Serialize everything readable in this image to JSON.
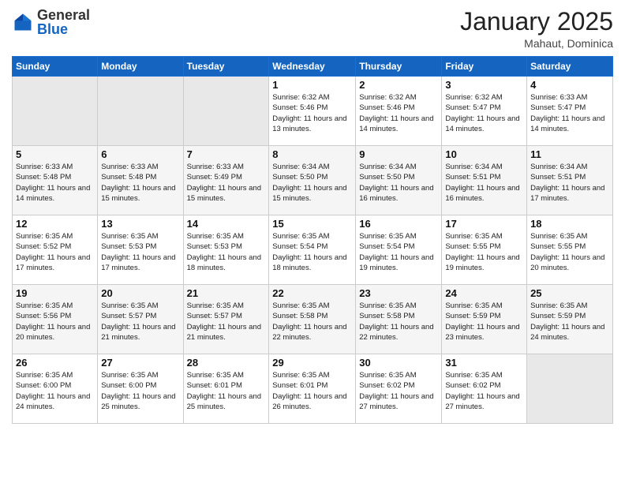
{
  "header": {
    "logo": {
      "general": "General",
      "blue": "Blue"
    },
    "title": "January 2025",
    "location": "Mahaut, Dominica"
  },
  "weekdays": [
    "Sunday",
    "Monday",
    "Tuesday",
    "Wednesday",
    "Thursday",
    "Friday",
    "Saturday"
  ],
  "weeks": [
    [
      {
        "day": "",
        "sunrise": "",
        "sunset": "",
        "daylight": ""
      },
      {
        "day": "",
        "sunrise": "",
        "sunset": "",
        "daylight": ""
      },
      {
        "day": "",
        "sunrise": "",
        "sunset": "",
        "daylight": ""
      },
      {
        "day": "1",
        "sunrise": "Sunrise: 6:32 AM",
        "sunset": "Sunset: 5:46 PM",
        "daylight": "Daylight: 11 hours and 13 minutes."
      },
      {
        "day": "2",
        "sunrise": "Sunrise: 6:32 AM",
        "sunset": "Sunset: 5:46 PM",
        "daylight": "Daylight: 11 hours and 14 minutes."
      },
      {
        "day": "3",
        "sunrise": "Sunrise: 6:32 AM",
        "sunset": "Sunset: 5:47 PM",
        "daylight": "Daylight: 11 hours and 14 minutes."
      },
      {
        "day": "4",
        "sunrise": "Sunrise: 6:33 AM",
        "sunset": "Sunset: 5:47 PM",
        "daylight": "Daylight: 11 hours and 14 minutes."
      }
    ],
    [
      {
        "day": "5",
        "sunrise": "Sunrise: 6:33 AM",
        "sunset": "Sunset: 5:48 PM",
        "daylight": "Daylight: 11 hours and 14 minutes."
      },
      {
        "day": "6",
        "sunrise": "Sunrise: 6:33 AM",
        "sunset": "Sunset: 5:48 PM",
        "daylight": "Daylight: 11 hours and 15 minutes."
      },
      {
        "day": "7",
        "sunrise": "Sunrise: 6:33 AM",
        "sunset": "Sunset: 5:49 PM",
        "daylight": "Daylight: 11 hours and 15 minutes."
      },
      {
        "day": "8",
        "sunrise": "Sunrise: 6:34 AM",
        "sunset": "Sunset: 5:50 PM",
        "daylight": "Daylight: 11 hours and 15 minutes."
      },
      {
        "day": "9",
        "sunrise": "Sunrise: 6:34 AM",
        "sunset": "Sunset: 5:50 PM",
        "daylight": "Daylight: 11 hours and 16 minutes."
      },
      {
        "day": "10",
        "sunrise": "Sunrise: 6:34 AM",
        "sunset": "Sunset: 5:51 PM",
        "daylight": "Daylight: 11 hours and 16 minutes."
      },
      {
        "day": "11",
        "sunrise": "Sunrise: 6:34 AM",
        "sunset": "Sunset: 5:51 PM",
        "daylight": "Daylight: 11 hours and 17 minutes."
      }
    ],
    [
      {
        "day": "12",
        "sunrise": "Sunrise: 6:35 AM",
        "sunset": "Sunset: 5:52 PM",
        "daylight": "Daylight: 11 hours and 17 minutes."
      },
      {
        "day": "13",
        "sunrise": "Sunrise: 6:35 AM",
        "sunset": "Sunset: 5:53 PM",
        "daylight": "Daylight: 11 hours and 17 minutes."
      },
      {
        "day": "14",
        "sunrise": "Sunrise: 6:35 AM",
        "sunset": "Sunset: 5:53 PM",
        "daylight": "Daylight: 11 hours and 18 minutes."
      },
      {
        "day": "15",
        "sunrise": "Sunrise: 6:35 AM",
        "sunset": "Sunset: 5:54 PM",
        "daylight": "Daylight: 11 hours and 18 minutes."
      },
      {
        "day": "16",
        "sunrise": "Sunrise: 6:35 AM",
        "sunset": "Sunset: 5:54 PM",
        "daylight": "Daylight: 11 hours and 19 minutes."
      },
      {
        "day": "17",
        "sunrise": "Sunrise: 6:35 AM",
        "sunset": "Sunset: 5:55 PM",
        "daylight": "Daylight: 11 hours and 19 minutes."
      },
      {
        "day": "18",
        "sunrise": "Sunrise: 6:35 AM",
        "sunset": "Sunset: 5:55 PM",
        "daylight": "Daylight: 11 hours and 20 minutes."
      }
    ],
    [
      {
        "day": "19",
        "sunrise": "Sunrise: 6:35 AM",
        "sunset": "Sunset: 5:56 PM",
        "daylight": "Daylight: 11 hours and 20 minutes."
      },
      {
        "day": "20",
        "sunrise": "Sunrise: 6:35 AM",
        "sunset": "Sunset: 5:57 PM",
        "daylight": "Daylight: 11 hours and 21 minutes."
      },
      {
        "day": "21",
        "sunrise": "Sunrise: 6:35 AM",
        "sunset": "Sunset: 5:57 PM",
        "daylight": "Daylight: 11 hours and 21 minutes."
      },
      {
        "day": "22",
        "sunrise": "Sunrise: 6:35 AM",
        "sunset": "Sunset: 5:58 PM",
        "daylight": "Daylight: 11 hours and 22 minutes."
      },
      {
        "day": "23",
        "sunrise": "Sunrise: 6:35 AM",
        "sunset": "Sunset: 5:58 PM",
        "daylight": "Daylight: 11 hours and 22 minutes."
      },
      {
        "day": "24",
        "sunrise": "Sunrise: 6:35 AM",
        "sunset": "Sunset: 5:59 PM",
        "daylight": "Daylight: 11 hours and 23 minutes."
      },
      {
        "day": "25",
        "sunrise": "Sunrise: 6:35 AM",
        "sunset": "Sunset: 5:59 PM",
        "daylight": "Daylight: 11 hours and 24 minutes."
      }
    ],
    [
      {
        "day": "26",
        "sunrise": "Sunrise: 6:35 AM",
        "sunset": "Sunset: 6:00 PM",
        "daylight": "Daylight: 11 hours and 24 minutes."
      },
      {
        "day": "27",
        "sunrise": "Sunrise: 6:35 AM",
        "sunset": "Sunset: 6:00 PM",
        "daylight": "Daylight: 11 hours and 25 minutes."
      },
      {
        "day": "28",
        "sunrise": "Sunrise: 6:35 AM",
        "sunset": "Sunset: 6:01 PM",
        "daylight": "Daylight: 11 hours and 25 minutes."
      },
      {
        "day": "29",
        "sunrise": "Sunrise: 6:35 AM",
        "sunset": "Sunset: 6:01 PM",
        "daylight": "Daylight: 11 hours and 26 minutes."
      },
      {
        "day": "30",
        "sunrise": "Sunrise: 6:35 AM",
        "sunset": "Sunset: 6:02 PM",
        "daylight": "Daylight: 11 hours and 27 minutes."
      },
      {
        "day": "31",
        "sunrise": "Sunrise: 6:35 AM",
        "sunset": "Sunset: 6:02 PM",
        "daylight": "Daylight: 11 hours and 27 minutes."
      },
      {
        "day": "",
        "sunrise": "",
        "sunset": "",
        "daylight": ""
      }
    ]
  ]
}
